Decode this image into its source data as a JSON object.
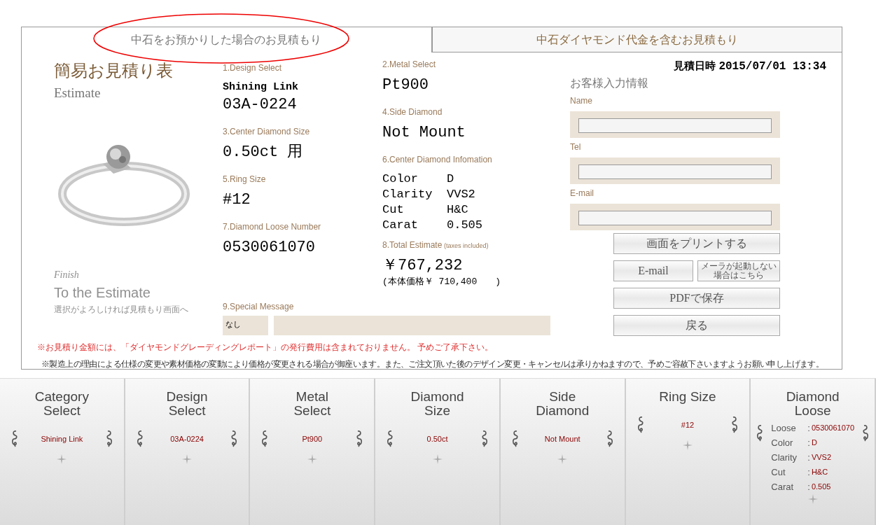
{
  "tabs": [
    {
      "label": "中石をお預かりした場合のお見積もり",
      "selected": true
    },
    {
      "label": "中石ダイヤモンド代金を含むお見積もり",
      "selected": false
    }
  ],
  "title": {
    "main": "簡易お見積り表",
    "sub": "Estimate"
  },
  "finish": {
    "kicker": "Finish",
    "heading": "To the Estimate",
    "note": "選択がよろしければ見積もり画面へ"
  },
  "columns": [
    [
      {
        "kind": "text",
        "label": "1.Design Select",
        "values": [
          "Shining Link",
          "03A-0224"
        ]
      },
      {
        "kind": "text",
        "label": "3.Center Diamond Size",
        "values": [
          "0.50ct 用"
        ]
      },
      {
        "kind": "text",
        "label": "5.Ring Size",
        "values": [
          "#12"
        ]
      },
      {
        "kind": "text",
        "label": "7.Diamond Loose Number",
        "values": [
          "0530061070"
        ]
      }
    ],
    [
      {
        "kind": "text",
        "label": "2.Metal Select",
        "values": [
          "Pt900"
        ]
      },
      {
        "kind": "text",
        "label": "4.Side Diamond",
        "values": [
          "Not Mount"
        ]
      },
      {
        "kind": "pairs",
        "label": "6.Center Diamond Infomation",
        "pairs": [
          {
            "name": "Color",
            "value": "D"
          },
          {
            "name": "Clarity",
            "value": "VVS2"
          },
          {
            "name": "Cut",
            "value": "H&C"
          },
          {
            "name": "Carat",
            "value": "0.505"
          }
        ]
      },
      {
        "kind": "price",
        "label": "8.Total Estimate",
        "label_note": "(taxes included)",
        "values": [
          "￥767,232"
        ],
        "note": "(本体価格￥ 710,400　　)"
      }
    ]
  ],
  "special_message": {
    "label": "9.Special Message",
    "value": "なし"
  },
  "notices": [
    {
      "kind": "warning",
      "text": "※お見積り金額には、「ダイヤモンドグレーディングレポート」の発行費用は含まれておりません。 予めご了承下さい。"
    },
    {
      "kind": "plain",
      "text": "※製造上の理由による仕様の変更や素材価格の変動により価格が変更される場合が御座います。また、ご注文頂いた後のデザイン変更・キャンセルは承りかねますので、予めご容赦下さいますようお願い申し上げます。"
    }
  ],
  "customer": {
    "date_label": "見積日時",
    "date": "2015/07/01 13:34",
    "heading": "お客様入力情報",
    "fields": [
      {
        "label": "Name"
      },
      {
        "label": "Tel"
      },
      {
        "label": "E-mail"
      }
    ],
    "button_rows": [
      [
        {
          "kind": "large",
          "label": "画面をプリントする"
        }
      ],
      [
        {
          "kind": "large",
          "label": "E-mail"
        },
        {
          "kind": "small",
          "lines": [
            "メーラが起動しない",
            "場合はこちら"
          ]
        }
      ],
      [
        {
          "kind": "large",
          "label": "PDFで保存"
        }
      ],
      [
        {
          "kind": "large",
          "label": "戻る"
        }
      ]
    ]
  },
  "steps": [
    {
      "kind": "single",
      "title": "Category Select",
      "value": "Shining Link"
    },
    {
      "kind": "single",
      "title": "Design Select",
      "value": "03A-0224"
    },
    {
      "kind": "single",
      "title": "Metal Select",
      "value": "Pt900"
    },
    {
      "kind": "single",
      "title": "Diamond Size",
      "value": "0.50ct"
    },
    {
      "kind": "single",
      "title": "Side Diamond",
      "value": "Not Mount"
    },
    {
      "kind": "single",
      "title": "Ring Size",
      "value": "#12"
    },
    {
      "kind": "details",
      "title": "Diamond Loose",
      "details": [
        {
          "name": "Loose",
          "sep": ":",
          "value": "0530061070"
        },
        {
          "name": "Color",
          "sep": ":",
          "value": "D"
        },
        {
          "name": "Clarity",
          "sep": ":",
          "value": "VVS2"
        },
        {
          "name": "Cut",
          "sep": ":",
          "value": "H&C"
        },
        {
          "name": "Carat",
          "sep": ":",
          "value": "0.505"
        }
      ]
    }
  ]
}
